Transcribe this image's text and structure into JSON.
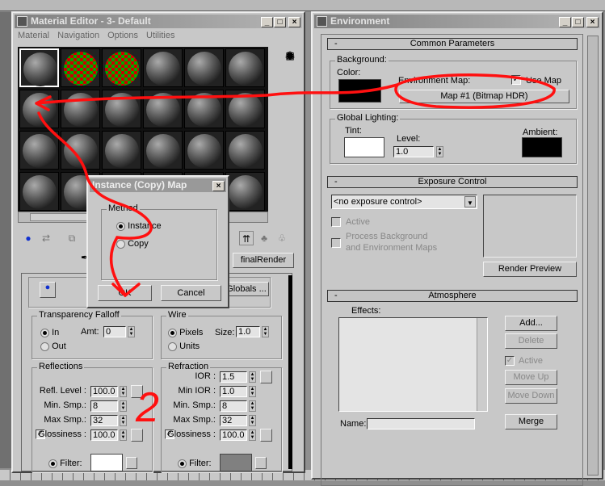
{
  "material_editor": {
    "title": "Material Editor - 3- Default",
    "menu": [
      "Material",
      "Navigation",
      "Options",
      "Utilities"
    ],
    "final_render_label": "finalRender",
    "globals_label": "Globals ...",
    "transparency": {
      "title": "Transparency Falloff",
      "in": "In",
      "out": "Out",
      "amt_label": "Amt:",
      "amt": "0"
    },
    "wire": {
      "title": "Wire",
      "pixels": "Pixels",
      "units": "Units",
      "size_label": "Size:",
      "size": "1.0"
    },
    "reflections": {
      "title": "Reflections",
      "refl_level_label": "Refl. Level :",
      "refl_level": "100.0",
      "min_smp_label": "Min. Smp.:",
      "min_smp": "8",
      "max_smp_label": "Max Smp.:",
      "max_smp": "32",
      "gloss_label": "Glossiness :",
      "gloss": "100.0",
      "filter_label": "Filter:"
    },
    "refraction": {
      "title": "Refraction",
      "ior_label": "IOR :",
      "ior": "1.5",
      "min_ior_label": "Min IOR :",
      "min_ior": "1.0",
      "min_smp_label": "Min. Smp.:",
      "min_smp": "8",
      "max_smp_label": "Max Smp.:",
      "max_smp": "32",
      "gloss_label": "Glossiness :",
      "gloss": "100.0",
      "filter_label": "Filter:"
    }
  },
  "dialog": {
    "title": "Instance (Copy) Map",
    "method": "Method",
    "instance": "Instance",
    "copy": "Copy",
    "ok": "OK",
    "cancel": "Cancel"
  },
  "environment": {
    "title": "Environment",
    "common": {
      "header": "Common Parameters",
      "background": "Background:",
      "color": "Color:",
      "env_map": "Environment Map:",
      "use_map": "Use Map",
      "map_button": "Map #1 (Bitmap HDR)",
      "global_lighting": "Global Lighting:",
      "tint": "Tint:",
      "level_label": "Level:",
      "level": "1.0",
      "ambient": "Ambient:"
    },
    "exposure": {
      "header": "Exposure Control",
      "dropdown": "<no exposure control>",
      "active": "Active",
      "process_1": "Process Background",
      "process_2": "and Environment Maps",
      "render_preview": "Render Preview"
    },
    "atmosphere": {
      "header": "Atmosphere",
      "effects": "Effects:",
      "add": "Add...",
      "delete": "Delete",
      "active": "Active",
      "move_up": "Move Up",
      "move_down": "Move Down",
      "merge": "Merge",
      "name_label": "Name:",
      "name": ""
    }
  },
  "annotation": {
    "number": "2"
  },
  "colors": {
    "annotation": "#ff1010",
    "panel": "#c8c8c8"
  }
}
